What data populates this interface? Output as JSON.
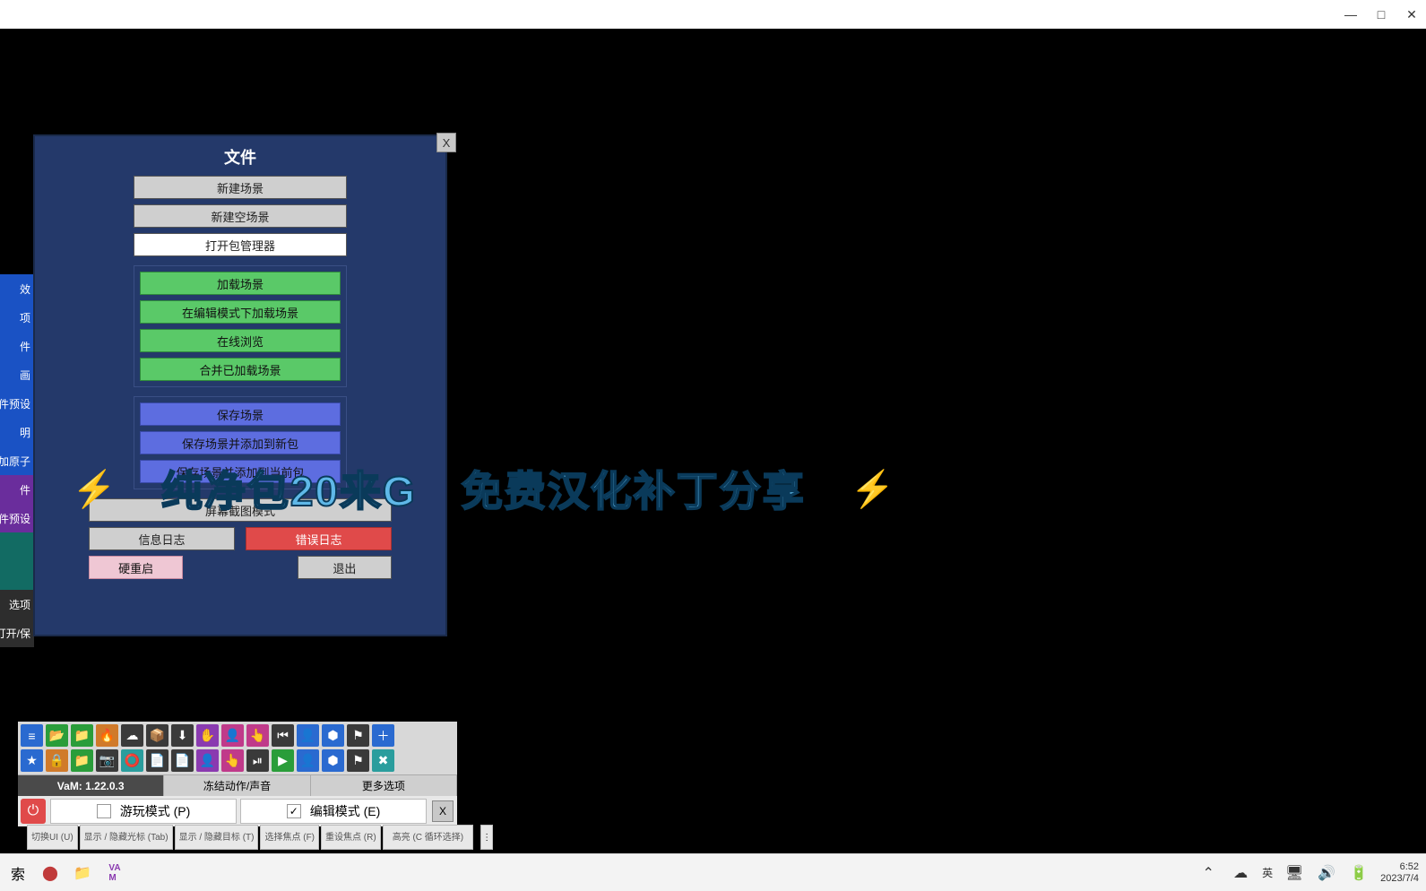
{
  "window": {
    "minimize": "—",
    "maximize": "□",
    "close": "✕"
  },
  "sideTabs": [
    {
      "label": "效",
      "cls": "st-blue1"
    },
    {
      "label": "项",
      "cls": "st-blue1"
    },
    {
      "label": "件",
      "cls": "st-blue1"
    },
    {
      "label": "画",
      "cls": "st-blue2"
    },
    {
      "label": "件预设",
      "cls": "st-blue2"
    },
    {
      "label": "明",
      "cls": "st-blue3"
    },
    {
      "label": "加原子",
      "cls": "st-blue3"
    },
    {
      "label": "件",
      "cls": "st-purple"
    },
    {
      "label": "件预设",
      "cls": "st-purple"
    },
    {
      "label": "",
      "cls": "st-teal"
    },
    {
      "label": "",
      "cls": "st-teal"
    },
    {
      "label": "选项",
      "cls": "st-dark"
    },
    {
      "label": "(打开/保",
      "cls": "st-dark"
    }
  ],
  "filePanel": {
    "title": "文件",
    "close": "X",
    "topButtons": [
      {
        "label": "新建场景",
        "cls": "btn-gray"
      },
      {
        "label": "新建空场景",
        "cls": "btn-gray"
      },
      {
        "label": "打开包管理器",
        "cls": "btn-white"
      }
    ],
    "greenGroup": [
      "加载场景",
      "在编辑模式下加载场景",
      "在线浏览",
      "合并已加载场景"
    ],
    "blueGroup": [
      "保存场景",
      "保存场景并添加到新包",
      "保存场景并添加到当前包"
    ],
    "screenshot": "屏幕截图模式",
    "logInfo": "信息日志",
    "logError": "错误日志",
    "hardReset": "硬重启",
    "exit": "退出"
  },
  "dock": {
    "version": "VaM: 1.22.0.3",
    "freeze": "冻结动作/声音",
    "more": "更多选项",
    "playMode": "游玩模式 (P)",
    "editMode": "编辑模式 (E)",
    "editChecked": "✓",
    "close": "X",
    "power": "⏻"
  },
  "miniTabs": [
    "切换UI (U)",
    "显示 / 隐藏光标 (Tab)",
    "显示 / 隐藏目标 (T)",
    "选择焦点 (F)",
    "重设焦点 (R)",
    "高亮 (C 循环选择)"
  ],
  "banner": {
    "left": "纯净包20来G",
    "right": "免费汉化补丁分享"
  },
  "taskbar": {
    "search": "索",
    "ime": "英",
    "time": "6:52",
    "date": "2023/7/4"
  },
  "iconRow1": [
    "≡",
    "📂",
    "📁",
    "🔥",
    "☁",
    "📦",
    "⬇",
    "✋",
    "👤",
    "👆",
    "⏮",
    "👤",
    "⬢",
    "⚑",
    "＋"
  ],
  "iconRow2": [
    "★",
    "🔒",
    "📁",
    "📷",
    "⭕",
    "📄",
    "📄",
    "👤",
    "👆",
    "⏯",
    "▶",
    "👤",
    "⬢",
    "⚑",
    "✖"
  ],
  "iconColors1": [
    "ic-blue",
    "ic-green",
    "ic-green",
    "ic-orange",
    "ic-dark",
    "ic-dark",
    "ic-dark",
    "ic-purple",
    "ic-pink",
    "ic-pink",
    "ic-dark",
    "ic-blue",
    "ic-blue",
    "ic-dark",
    "ic-blue"
  ],
  "iconColors2": [
    "ic-blue",
    "ic-orange",
    "ic-green",
    "ic-dark",
    "ic-teal",
    "ic-dark",
    "ic-dark",
    "ic-purple",
    "ic-pink",
    "ic-dark",
    "ic-green",
    "ic-blue",
    "ic-blue",
    "ic-dark",
    "ic-teal"
  ]
}
